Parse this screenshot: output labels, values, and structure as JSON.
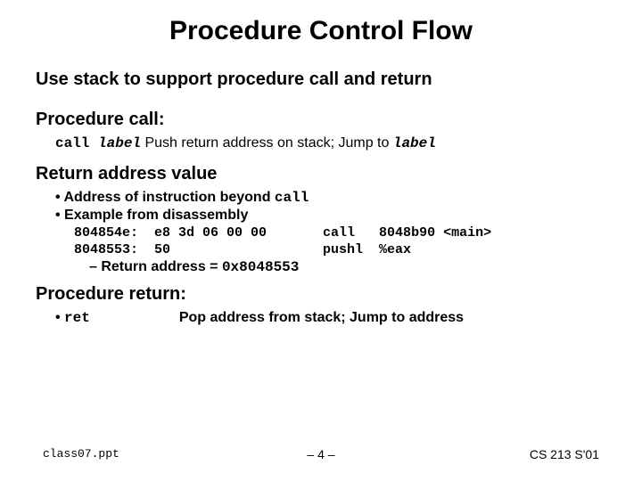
{
  "title": "Procedure Control Flow",
  "sections": {
    "use_stack": "Use stack to support procedure call and return",
    "procedure_call": "Procedure call:",
    "call_line": {
      "call": "call ",
      "label": "label",
      "rest": " Push return address on stack; Jump to ",
      "label2": "label"
    },
    "return_value": "Return address value",
    "ret_bullets": {
      "b1_pre": "Address of instruction beyond ",
      "b1_code": "call",
      "b2": "Example from disassembly",
      "asm1": " 804854e:  e8 3d 06 00 00       call   8048b90 <main>",
      "asm2": " 8048553:  50                   pushl  %eax",
      "dash_pre": "Return address = ",
      "dash_code": "0x8048553"
    },
    "procedure_return": "Procedure return:",
    "ret_row": {
      "ret": "ret",
      "desc": "Pop address from stack; Jump to address"
    }
  },
  "footer": {
    "left": "class07.ppt",
    "mid": "– 4 –",
    "right": "CS 213 S'01"
  }
}
